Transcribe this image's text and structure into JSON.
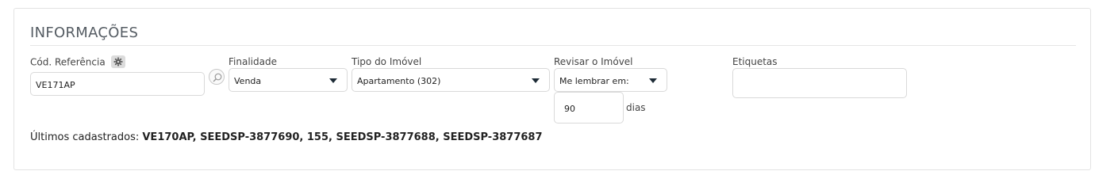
{
  "section": {
    "title": "INFORMAÇÕES"
  },
  "fields": {
    "ref": {
      "label": "Cód. Referência",
      "value": "VE171AP"
    },
    "finalidade": {
      "label": "Finalidade",
      "value": "Venda"
    },
    "tipo": {
      "label": "Tipo do Imóvel",
      "value": "Apartamento (302)"
    },
    "revisar": {
      "label": "Revisar o Imóvel",
      "value": "Me lembrar em:",
      "days_value": "90",
      "days_unit": "dias"
    },
    "etiquetas": {
      "label": "Etiquetas",
      "value": ""
    }
  },
  "recent": {
    "prefix": "Últimos cadastrados:",
    "items": "VE170AP, SEEDSP-3877690, 155, SEEDSP-3877688, SEEDSP-3877687"
  },
  "icons": {
    "settings": "gear-icon",
    "search": "magnifier-icon",
    "dropdown": "caret-down-icon"
  },
  "colors": {
    "caret": "#1d2b36",
    "border": "#d9d9d9"
  }
}
